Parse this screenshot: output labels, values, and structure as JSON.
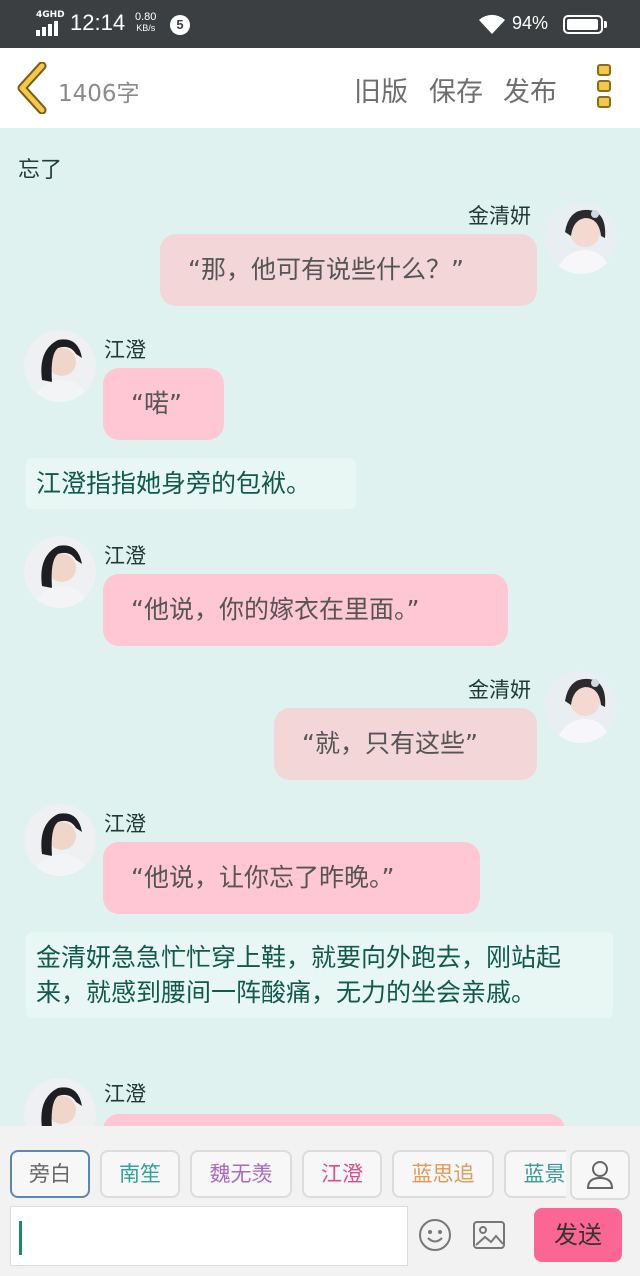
{
  "status_bar": {
    "network": "4GHD",
    "time": "12:14",
    "speed_value": "0.80",
    "speed_unit": "KB/s",
    "notification_count": "5",
    "battery_percent": "94%"
  },
  "header": {
    "word_count": "1406字",
    "actions": {
      "old_version": "旧版",
      "save": "保存",
      "publish": "发布"
    },
    "icons": {
      "back": "chevron-left-icon",
      "menu": "vertical-dots-menu-icon"
    },
    "accent_color": "#f5c84b"
  },
  "chat": {
    "partial_top_text": "忘了",
    "messages": [
      {
        "kind": "dialogue",
        "side": "right",
        "speaker": "金清妍",
        "text": "“那，他可有说些什么？”"
      },
      {
        "kind": "dialogue",
        "side": "left",
        "speaker": "江澄",
        "text": "“喏”"
      },
      {
        "kind": "narration",
        "text": "江澄指指她身旁的包袱。"
      },
      {
        "kind": "dialogue",
        "side": "left",
        "speaker": "江澄",
        "text": "“他说，你的嫁衣在里面。”"
      },
      {
        "kind": "dialogue",
        "side": "right",
        "speaker": "金清妍",
        "text": "“就，只有这些”"
      },
      {
        "kind": "dialogue",
        "side": "left",
        "speaker": "江澄",
        "text": "“他说，让你忘了昨晚。”"
      },
      {
        "kind": "narration",
        "text": "金清妍急急忙忙穿上鞋，就要向外跑去，刚站起来，就感到腰间一阵酸痛，无力的坐会亲戚。"
      },
      {
        "kind": "dialogue",
        "side": "left",
        "speaker": "江澄",
        "text": ""
      }
    ],
    "colors": {
      "background": "#dff2ef",
      "left_bubble": "#ffc7d3",
      "right_bubble": "#f2d6d8",
      "narration_text": "#0f5a4a"
    }
  },
  "bottom": {
    "characters": [
      {
        "label": "旁白",
        "color": "#666666",
        "selected": true
      },
      {
        "label": "南笙",
        "color": "#2fa39a",
        "selected": false
      },
      {
        "label": "魏无羡",
        "color": "#a76bbf",
        "selected": false
      },
      {
        "label": "江澄",
        "color": "#d9508c",
        "selected": false
      },
      {
        "label": "蓝思追",
        "color": "#e09a5a",
        "selected": false
      },
      {
        "label": "蓝景仪",
        "color": "#3a9a9a",
        "selected": false
      }
    ],
    "input_value": "",
    "send_label": "发送",
    "icons": {
      "profile": "person-icon",
      "emoji": "smiley-icon",
      "image": "image-icon"
    },
    "send_color": "#fb6694"
  }
}
